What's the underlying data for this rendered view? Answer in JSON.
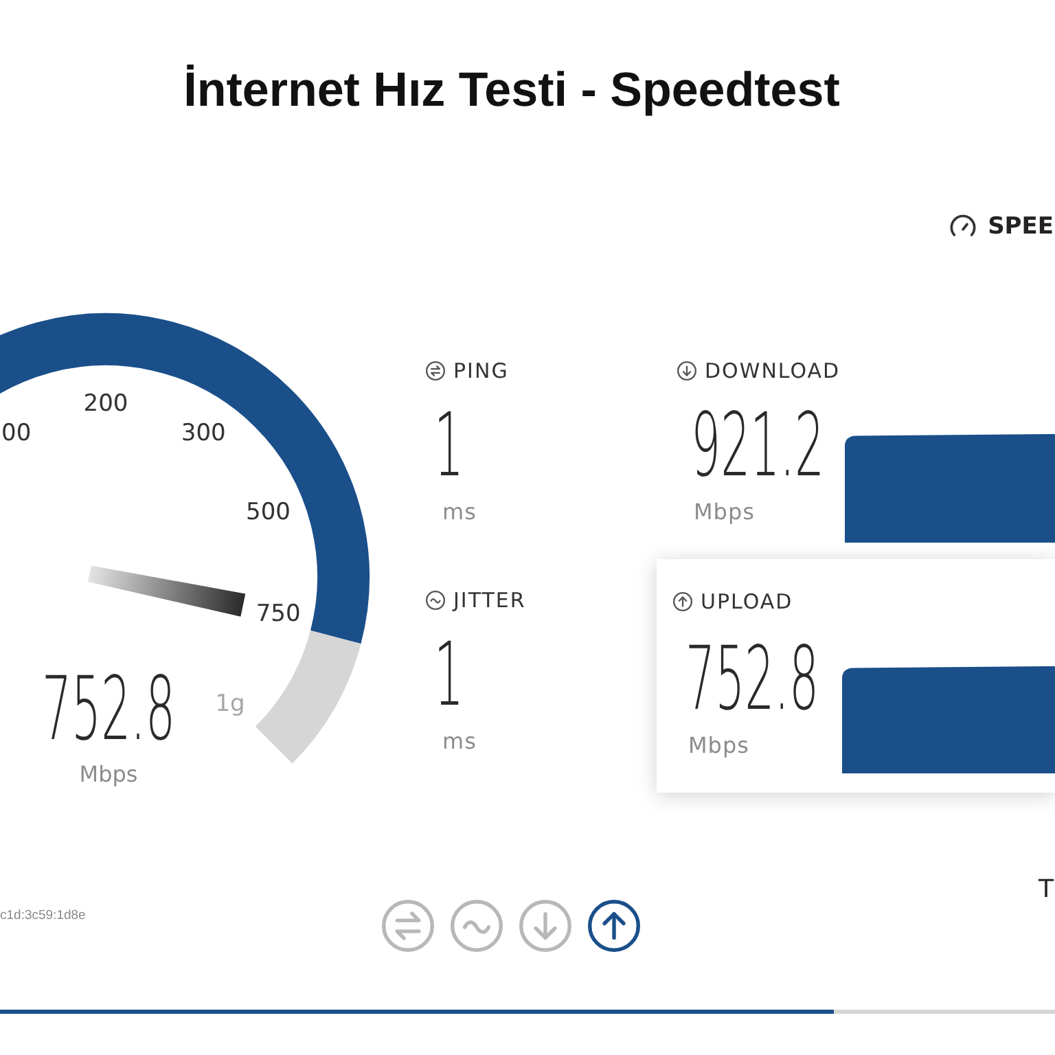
{
  "title": "İnternet Hız Testi - Speedtest",
  "corner_heading": {
    "label": "SPEE"
  },
  "gauge": {
    "scale_labels": [
      "00",
      "200",
      "300",
      "500",
      "750",
      "1g"
    ],
    "reading": "752.8",
    "unit": "Mbps"
  },
  "metrics": [
    {
      "kind": "ping",
      "label": "PING",
      "value": "1",
      "unit": "ms"
    },
    {
      "kind": "jitter",
      "label": "JITTER",
      "value": "1",
      "unit": "ms"
    }
  ],
  "results": [
    {
      "kind": "download",
      "label": "DOWNLOAD",
      "value": "921.2",
      "unit": "Mbps",
      "active": false
    },
    {
      "kind": "upload",
      "label": "UPLOAD",
      "value": "752.8",
      "unit": "Mbps",
      "active": true
    }
  ],
  "footer": {
    "address": "c1d:3c59:1d8e",
    "side_text": "T"
  },
  "steps": [
    {
      "kind": "ping",
      "selected": false
    },
    {
      "kind": "jitter",
      "selected": false
    },
    {
      "kind": "download",
      "selected": false
    },
    {
      "kind": "upload",
      "selected": true
    }
  ],
  "progress": {
    "level": 0.79
  }
}
